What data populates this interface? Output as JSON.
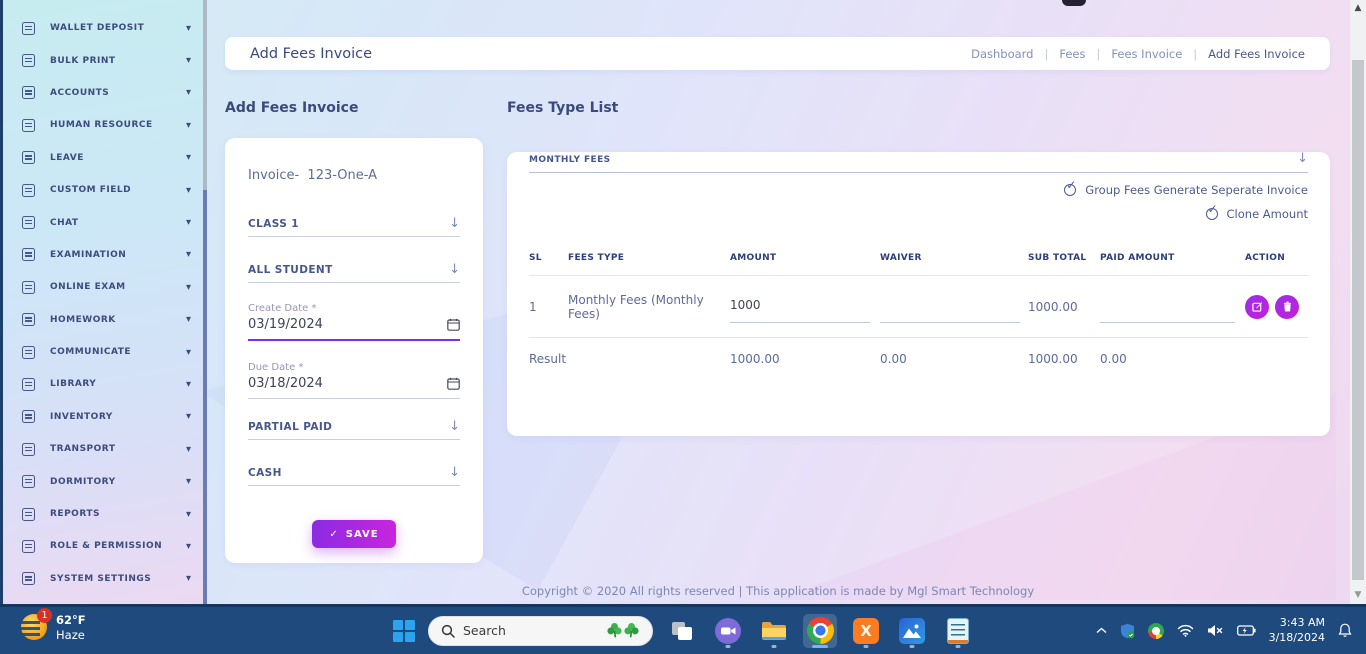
{
  "colors": {
    "accent_purple_start": "#8a2be2",
    "accent_purple_end": "#c925dd",
    "navy_text": "#3a4a7c",
    "slate_text": "#5d6c99",
    "taskbar_bg": "#1e4a7d"
  },
  "icons": {
    "caret_down": "▾",
    "select_arrow": "↓",
    "check": "✓",
    "scroll_up": "▲",
    "scroll_down": "▼",
    "xampp_letter": "X"
  },
  "sidebar": {
    "items": [
      {
        "label": "WALLET DEPOSIT",
        "icon": "wallet-deposit-icon"
      },
      {
        "label": "BULK PRINT",
        "icon": "bulk-print-icon"
      },
      {
        "label": "ACCOUNTS",
        "icon": "accounts-icon"
      },
      {
        "label": "HUMAN RESOURCE",
        "icon": "human-resource-icon"
      },
      {
        "label": "LEAVE",
        "icon": "leave-icon"
      },
      {
        "label": "CUSTOM FIELD",
        "icon": "custom-field-icon"
      },
      {
        "label": "CHAT",
        "icon": "chat-icon"
      },
      {
        "label": "EXAMINATION",
        "icon": "examination-icon"
      },
      {
        "label": "ONLINE EXAM",
        "icon": "online-exam-icon"
      },
      {
        "label": "HOMEWORK",
        "icon": "homework-icon"
      },
      {
        "label": "COMMUNICATE",
        "icon": "communicate-icon"
      },
      {
        "label": "LIBRARY",
        "icon": "library-icon"
      },
      {
        "label": "INVENTORY",
        "icon": "inventory-icon"
      },
      {
        "label": "TRANSPORT",
        "icon": "transport-icon"
      },
      {
        "label": "DORMITORY",
        "icon": "dormitory-icon"
      },
      {
        "label": "REPORTS",
        "icon": "reports-icon"
      },
      {
        "label": "ROLE & PERMISSION",
        "icon": "role-permission-icon"
      },
      {
        "label": "SYSTEM SETTINGS",
        "icon": "system-settings-icon"
      }
    ]
  },
  "header": {
    "title": "Add Fees Invoice",
    "separator": "|",
    "breadcrumb": [
      {
        "label": "Dashboard"
      },
      {
        "label": "Fees"
      },
      {
        "label": "Fees Invoice"
      },
      {
        "label": "Add Fees Invoice"
      }
    ]
  },
  "form": {
    "section_title": "Add Fees Invoice",
    "invoice_label": "Invoice-  123-One-A",
    "class_select": "CLASS 1",
    "student_select": "ALL STUDENT",
    "create_date_label": "Create Date *",
    "create_date_value": "03/19/2024",
    "due_date_label": "Due Date *",
    "due_date_value": "03/18/2024",
    "partial_paid_select": "PARTIAL PAID",
    "payment_select": "CASH",
    "save_label": "SAVE"
  },
  "fees": {
    "section_title": "Fees Type List",
    "fees_type_select": "MONTHLY FEES",
    "group_option": "Group Fees Generate Seperate Invoice",
    "clone_option": "Clone Amount",
    "table": {
      "headers": [
        "SL",
        "FEES TYPE",
        "AMOUNT",
        "WAIVER",
        "SUB TOTAL",
        "PAID AMOUNT",
        "ACTION"
      ],
      "rows": [
        {
          "sl": "1",
          "fees_type": "Monthly Fees (Monthly Fees)",
          "amount": "1000",
          "waiver": "",
          "sub_total": "1000.00",
          "paid_amount": ""
        }
      ],
      "result": {
        "label": "Result",
        "amount": "1000.00",
        "waiver": "0.00",
        "sub_total": "1000.00",
        "paid_amount": "0.00"
      }
    }
  },
  "footer": {
    "copyright": "Copyright © 2020 All rights reserved | This application is made by Mgl Smart Technology"
  },
  "taskbar": {
    "weather": {
      "badge": "1",
      "temp": "62°F",
      "condition": "Haze"
    },
    "search": {
      "placeholder": "Search"
    },
    "tray": {
      "time": "3:43 AM",
      "date": "3/18/2024"
    }
  }
}
